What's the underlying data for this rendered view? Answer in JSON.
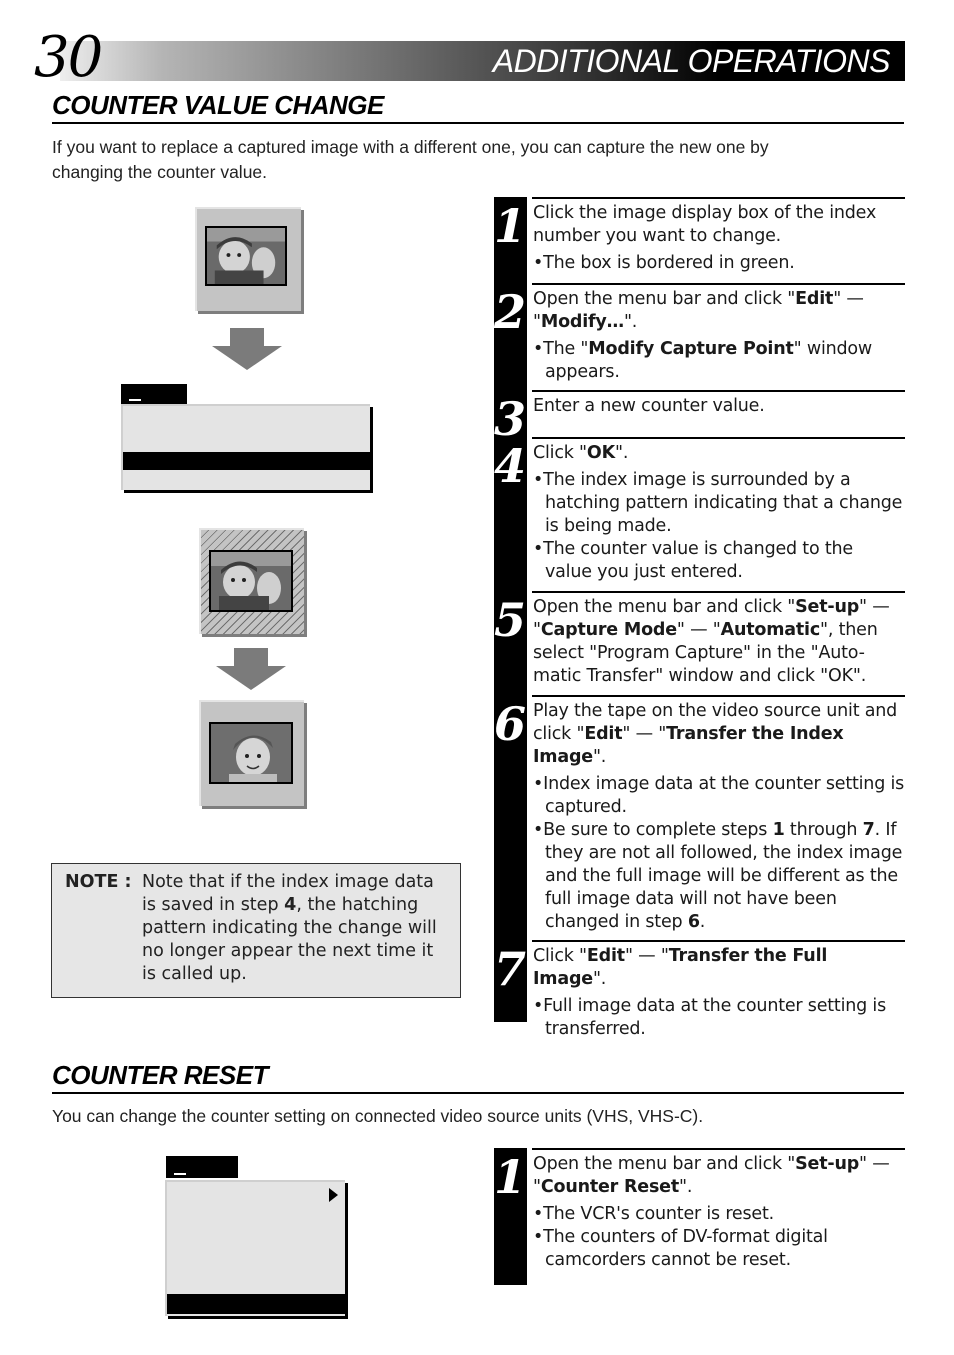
{
  "header": {
    "page_number": "30",
    "title": "ADDITIONAL OPERATIONS"
  },
  "counter_value_change": {
    "title": "COUNTER VALUE CHANGE",
    "intro_line1": "If you want to replace a captured image with a different one, you can capture the new one by",
    "intro_line2": "changing the counter value.",
    "note": {
      "label": "NOTE :",
      "text_before": "Note that if the index image data is saved in step ",
      "step_ref": "4",
      "text_after": ", the hatching pattern indicating the change will no longer appear the next time it is called up."
    },
    "steps": [
      {
        "number": "1",
        "main": [
          {
            "t": "Click the image display box of the index number you want to change."
          }
        ],
        "bullets": [
          [
            {
              "t": "The box is bordered in green."
            }
          ]
        ]
      },
      {
        "number": "2",
        "main": [
          {
            "t": "Open the menu bar and click \""
          },
          {
            "b": "Edit"
          },
          {
            "t": "\" — \""
          },
          {
            "b": "Modify…"
          },
          {
            "t": "\"."
          }
        ],
        "bullets": [
          [
            {
              "t": "The \""
            },
            {
              "b": "Modify Capture Point"
            },
            {
              "t": "\" window appears."
            }
          ]
        ]
      },
      {
        "number": "3",
        "main": [
          {
            "t": "Enter a new counter value."
          }
        ],
        "bullets": []
      },
      {
        "number": "4",
        "main": [
          {
            "t": "Click \""
          },
          {
            "b": "OK"
          },
          {
            "t": "\"."
          }
        ],
        "bullets": [
          [
            {
              "t": "The index image is surrounded by a hatching pattern indicating that a change is being made."
            }
          ],
          [
            {
              "t": "The counter value is changed to the value you just entered."
            }
          ]
        ]
      },
      {
        "number": "5",
        "main": [
          {
            "t": "Open the menu bar and click \""
          },
          {
            "b": "Set-up"
          },
          {
            "t": "\" — \""
          },
          {
            "b": "Capture Mode"
          },
          {
            "t": "\" — \""
          },
          {
            "b": "Automatic"
          },
          {
            "t": "\", then select \"Program Capture\" in the \"Auto-matic Transfer\" window and click \"OK\"."
          }
        ],
        "bullets": []
      },
      {
        "number": "6",
        "main": [
          {
            "t": "Play the tape on the video source unit and click \""
          },
          {
            "b": "Edit"
          },
          {
            "t": "\" — \""
          },
          {
            "b": "Transfer the Index Image"
          },
          {
            "t": "\"."
          }
        ],
        "bullets": [
          [
            {
              "t": "Index image data at the counter setting is captured."
            }
          ],
          [
            {
              "t": "Be sure to complete steps "
            },
            {
              "b": "1"
            },
            {
              "t": " through "
            },
            {
              "b": "7"
            },
            {
              "t": ". If they are not all followed, the index image and the full image will be different as the full image data will not have been changed in step "
            },
            {
              "b": "6"
            },
            {
              "t": "."
            }
          ]
        ]
      },
      {
        "number": "7",
        "main": [
          {
            "t": "Click \""
          },
          {
            "b": "Edit"
          },
          {
            "t": "\" — \""
          },
          {
            "b": "Transfer the Full Image"
          },
          {
            "t": "\"."
          }
        ],
        "bullets": [
          [
            {
              "t": "Full image data at the counter setting is transferred."
            }
          ]
        ]
      }
    ]
  },
  "counter_reset": {
    "title": "COUNTER RESET",
    "intro": "You can change the counter setting on connected video source units (VHS, VHS-C).",
    "steps": [
      {
        "number": "1",
        "main": [
          {
            "t": "Open the menu bar and click \""
          },
          {
            "b": "Set-up"
          },
          {
            "t": "\" — \""
          },
          {
            "b": "Counter Reset"
          },
          {
            "t": "\"."
          }
        ],
        "bullets": [
          [
            {
              "t": "The VCR's counter is reset."
            }
          ],
          [
            {
              "t": "The counters of DV-format digital camcorders cannot be reset."
            }
          ]
        ]
      }
    ]
  },
  "illustrations": {
    "tiles": [
      "index-image-selected",
      "index-image-hatched",
      "full-image-new"
    ],
    "arrows": [
      "arrow-down",
      "arrow-down"
    ],
    "icons": {
      "submenu_arrow": "triangle-right-icon"
    }
  }
}
